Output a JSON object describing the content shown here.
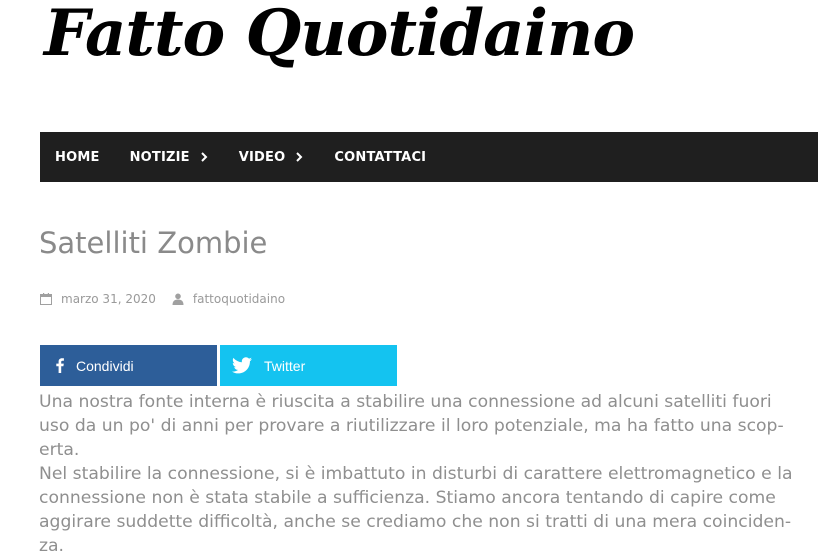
{
  "site": {
    "title": "Fatto Quotidaino"
  },
  "nav": {
    "items": [
      {
        "label": "HOME",
        "has_submenu": false
      },
      {
        "label": "NOTIZIE",
        "has_submenu": true
      },
      {
        "label": "VIDEO",
        "has_submenu": true
      },
      {
        "label": "CONTATTACI",
        "has_submenu": false
      }
    ]
  },
  "post": {
    "title": "Satelliti Zombie",
    "date": "marzo 31, 2020",
    "author": "fattoquotidaino",
    "paragraphs": [
      "Una nostra fonte interna è riuscita a stabilire una connessione ad alcuni satelliti fuori uso da un po' di anni per provare a riutilizzare il loro potenziale, ma ha fatto una scop- erta.",
      "Nel stabilire la connessione, si è imbattuto in disturbi di carattere elettromagnetico e la connessione non è stata stabile a sufficienza. Stiamo ancora tentando di capire come aggirare suddette difficoltà, anche se crediamo che non si tratti di una mera coinciden- za."
    ]
  },
  "share": {
    "facebook_label": "Condividi",
    "twitter_label": "Twitter"
  },
  "colors": {
    "nav_bg": "#1f1f1f",
    "facebook": "#2d5e99",
    "twitter": "#14c3f0",
    "text_gray": "#8f8f8f"
  }
}
